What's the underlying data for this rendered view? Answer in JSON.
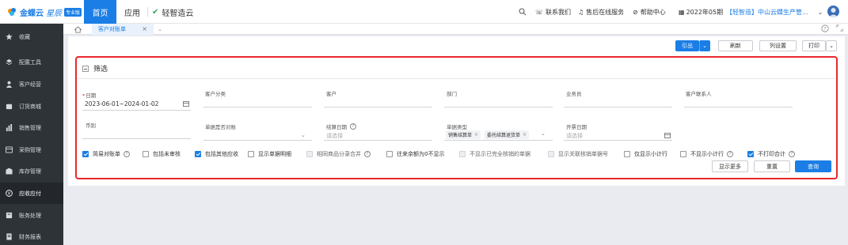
{
  "header": {
    "logo_text": "金蝶云",
    "logo_sub": "星辰",
    "logo_badge": "专业版",
    "nav_home": "首页",
    "nav_app": "应用",
    "nav_light": "轻智造云",
    "contact": "联系我们",
    "service": "售后在线服务",
    "help": "帮助中心",
    "period": "2022年05期",
    "company": "【轻智造】中山云蝶生产管..."
  },
  "sidebar": {
    "items": [
      {
        "label": "收藏",
        "icon": "star-icon"
      },
      {
        "label": "配置工具",
        "icon": "layers-icon"
      },
      {
        "label": "客户经营",
        "icon": "user-icon"
      },
      {
        "label": "订货商城",
        "icon": "cart-icon"
      },
      {
        "label": "销售管理",
        "icon": "bar-chart-icon"
      },
      {
        "label": "采购管理",
        "icon": "purchase-icon"
      },
      {
        "label": "库存管理",
        "icon": "inventory-icon"
      },
      {
        "label": "应收应付",
        "icon": "money-icon"
      },
      {
        "label": "账务处理",
        "icon": "ledger-icon"
      },
      {
        "label": "财务报表",
        "icon": "report-icon"
      }
    ],
    "active_index": 7
  },
  "tabs": {
    "current": "客户对账单"
  },
  "toolbar": {
    "export": "引出",
    "refresh": "刷新",
    "columns": "列设置",
    "print": "打印"
  },
  "filter": {
    "title": "筛选",
    "fields": {
      "date_label": "日期",
      "date_value": "2023-06-01~2024-01-02",
      "customer_category": "客户分类",
      "customer": "客户",
      "department": "部门",
      "salesperson": "业务员",
      "customer_contact": "客户联系人",
      "currency": "币别",
      "doc_reconcile": "单据是否对账",
      "settle_date": "结算日期",
      "settle_date_placeholder": "请选择",
      "doc_type": "单据类型",
      "doc_type_tags": [
        "销售结算单",
        "委托结算退货单"
      ],
      "invoice_date": "开票日期",
      "invoice_date_placeholder": "请选择"
    },
    "checkboxes": [
      {
        "label": "简易对账单",
        "checked": true,
        "help": true
      },
      {
        "label": "包括未审核",
        "checked": false
      },
      {
        "label": "包括其他应收",
        "checked": true
      },
      {
        "label": "显示单据明细",
        "checked": false
      },
      {
        "label": "相同商品分录合并",
        "checked": false,
        "disabled": true,
        "help": true
      },
      {
        "label": "往来余额为0不显示",
        "checked": false
      },
      {
        "label": "不显示已完全核销的单据",
        "checked": false,
        "disabled": true
      },
      {
        "label": "显示关联核销单据号",
        "checked": false,
        "disabled": true
      },
      {
        "label": "仅显示小计行",
        "checked": false
      },
      {
        "label": "不显示小计行",
        "checked": false,
        "help": true
      },
      {
        "label": "不打印合计",
        "checked": true,
        "help": true
      }
    ],
    "show_more": "显示更多",
    "reset": "重置",
    "query": "查询"
  }
}
